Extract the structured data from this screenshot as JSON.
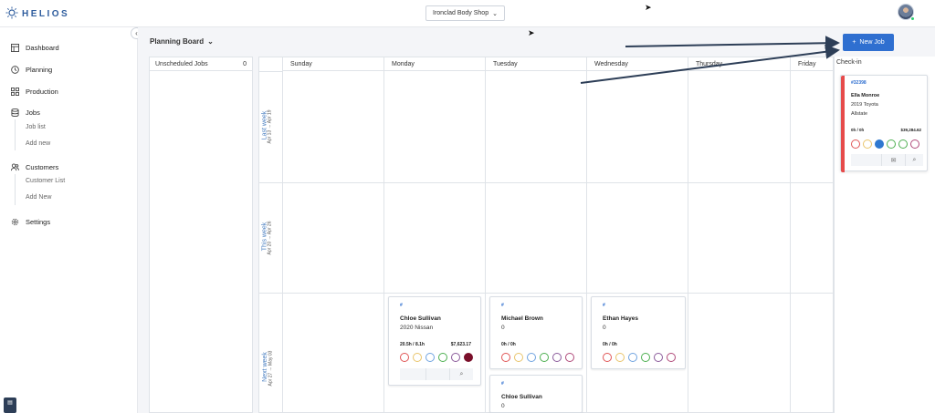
{
  "app": {
    "name": "HELIOS"
  },
  "shop": {
    "selected": "Ironclad Body Shop"
  },
  "sidebar": {
    "items": [
      {
        "label": "Dashboard",
        "icon": "dashboard-icon"
      },
      {
        "label": "Planning",
        "icon": "clock-icon"
      },
      {
        "label": "Production",
        "icon": "grid-icon"
      },
      {
        "label": "Jobs",
        "icon": "database-icon"
      },
      {
        "label": "Customers",
        "icon": "users-icon"
      },
      {
        "label": "Settings",
        "icon": "gear-icon"
      }
    ],
    "jobs_sub": [
      "Job list",
      "Add new"
    ],
    "customers_sub": [
      "Customer List",
      "Add New"
    ]
  },
  "planning": {
    "title": "Planning Board",
    "unscheduled_label": "Unscheduled Jobs",
    "unscheduled_count": "0",
    "days": [
      "Sunday",
      "Monday",
      "Tuesday",
      "Wednesday",
      "Thursday",
      "Friday"
    ],
    "weeks": [
      {
        "label": "Last week",
        "range": "Apr 13 → Apr 19"
      },
      {
        "label": "This week",
        "range": "Apr 20 → Apr 26"
      },
      {
        "label": "Next week",
        "range": "Apr 27 → May 03"
      }
    ],
    "new_job_label": "New Job",
    "checkin_label": "Check-in"
  },
  "cards": [
    {
      "hash": "#",
      "name": "Chloe Sullivan",
      "vehicle": "2020 Nissan",
      "hours": "20.5h / 8.1h",
      "amount": "$7,623.17",
      "circles": [
        "#e05555",
        "#e9c46a",
        "#6fa3e0",
        "#4caf50",
        "#8a5a9a",
        "#7a0f2a"
      ],
      "filled": [
        5
      ]
    },
    {
      "hash": "#",
      "name": "Michael Brown",
      "vehicle": "0",
      "hours": "0h / 0h",
      "amount": "",
      "circles": [
        "#e05555",
        "#e9c46a",
        "#6fa3e0",
        "#4caf50",
        "#8a5a9a",
        "#b04a7a"
      ],
      "filled": []
    },
    {
      "hash": "#",
      "name": "Ethan Hayes",
      "vehicle": "0",
      "hours": "0h / 0h",
      "amount": "",
      "circles": [
        "#e05555",
        "#e9c46a",
        "#6fa3e0",
        "#4caf50",
        "#8a5a9a",
        "#b04a7a"
      ],
      "filled": []
    },
    {
      "hash": "#",
      "name": "Chloe Sullivan",
      "vehicle": "0",
      "hours": "",
      "amount": "",
      "circles": [],
      "filled": []
    }
  ],
  "checkin_card": {
    "ro": "#32398",
    "name": "Ella Monroe",
    "vehicle": "2019 Toyota",
    "insurer": "Allstate",
    "hours": "0h / 0h",
    "amount": "$39,284.62",
    "circles": [
      "#e05555",
      "#e9c46a",
      "#2f78d0",
      "#4caf50",
      "#4caf50",
      "#b04a7a"
    ],
    "filled": [
      2
    ]
  }
}
